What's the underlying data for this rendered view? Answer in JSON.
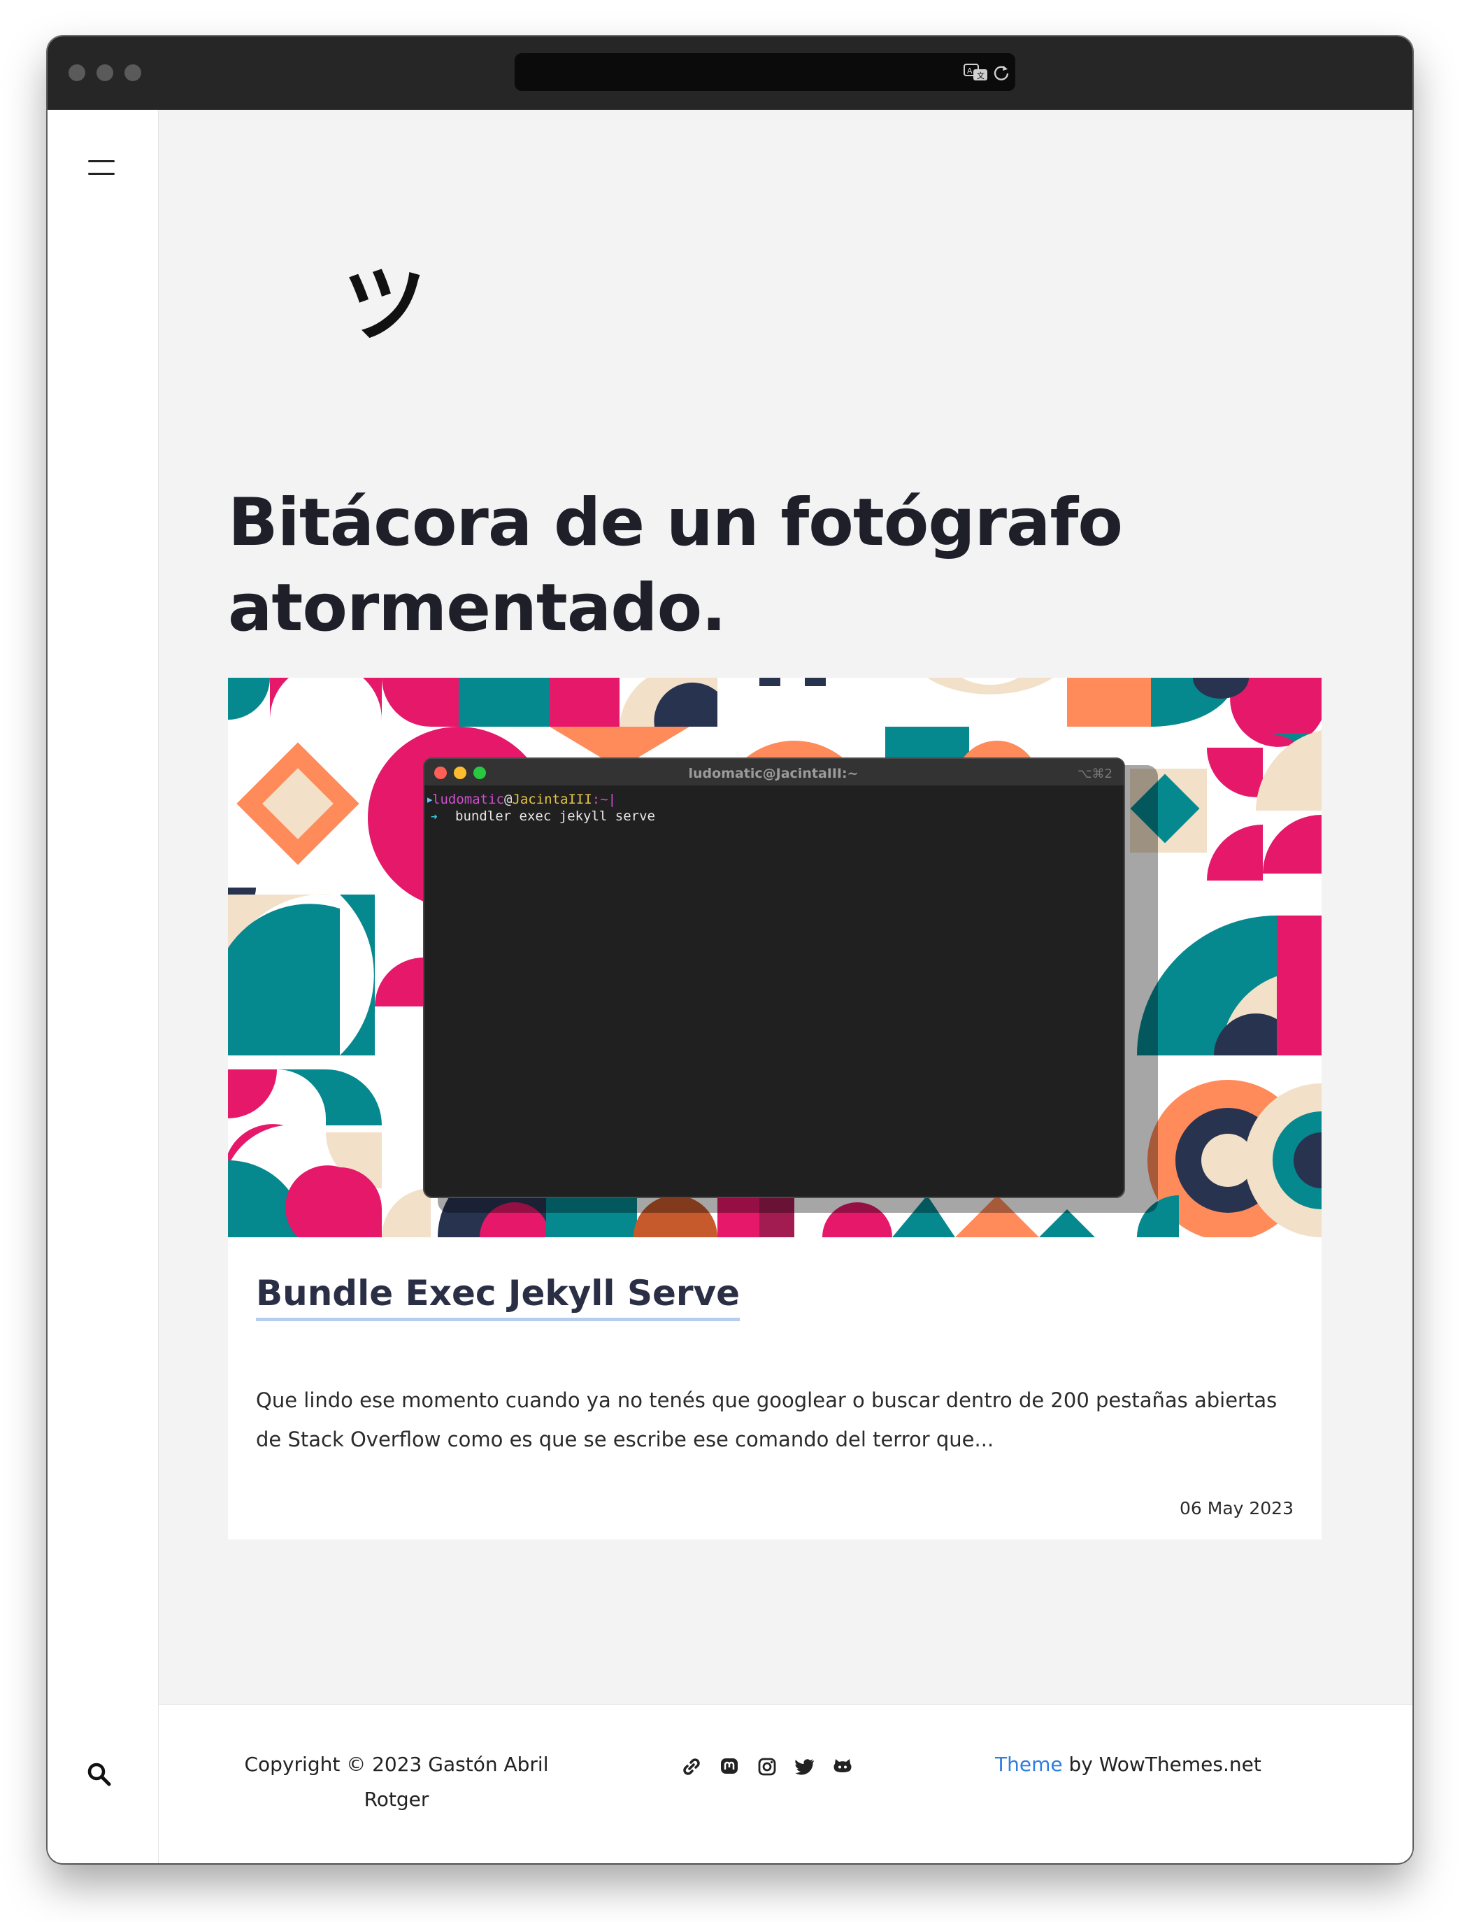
{
  "browser": {
    "translate_icon": "translate-icon",
    "reload_icon": "reload-icon"
  },
  "sidebar": {
    "menu_icon": "hamburger-menu-icon",
    "search_icon": "search-icon"
  },
  "site": {
    "logo_text": "ツ",
    "headline": "Bitácora de un fotógrafo atormentado."
  },
  "post": {
    "image": {
      "terminal_title": "ludomatic@JacintaIII:~",
      "terminal_shortcut": "⌥⌘2",
      "prompt_user": "ludomatic",
      "prompt_at": "@",
      "prompt_host": "JacintaIII",
      "prompt_path": ":~|",
      "command_arrow": "➜",
      "command": "bundler exec jekyll serve"
    },
    "title": "Bundle Exec Jekyll Serve",
    "excerpt": "Que lindo ese momento cuando ya no tenés que googlear o buscar dentro de 200 pestañas abiertas de Stack Overflow como es que se escribe ese comando del terror que...",
    "date": "06 May 2023"
  },
  "footer": {
    "copyright": "Copyright © 2023 Gastón Abril Rotger",
    "social_icons": [
      "link-icon",
      "mastodon-icon",
      "instagram-icon",
      "twitter-icon",
      "github-icon"
    ],
    "credit_link": "Theme",
    "credit_text": " by WowThemes.net"
  },
  "colors": {
    "accent_link": "#2f7de0",
    "title_underline": "#b7cdee",
    "pattern_teal": "#06888f",
    "pattern_pink": "#e5186a",
    "pattern_orange": "#ff8a5a",
    "pattern_cream": "#f2e0c8",
    "pattern_navy": "#283350"
  }
}
